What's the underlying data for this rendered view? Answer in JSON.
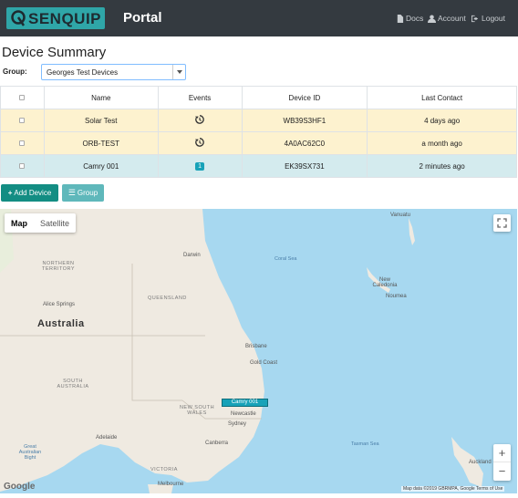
{
  "header": {
    "logo_text": "SENQUIP",
    "brand": "Portal",
    "links": {
      "docs": "Docs",
      "account": "Account",
      "logout": "Logout"
    }
  },
  "page": {
    "title": "Device Summary",
    "group_label": "Group:",
    "group_value": "Georges Test Devices"
  },
  "table": {
    "headers": {
      "name": "Name",
      "events": "Events",
      "device_id": "Device ID",
      "last_contact": "Last Contact"
    },
    "rows": [
      {
        "name": "Solar Test",
        "events": "history-icon",
        "device_id": "WB39S3HF1",
        "last_contact": "4 days ago",
        "status": "warning"
      },
      {
        "name": "ORB-TEST",
        "events": "history-icon",
        "device_id": "4A0AC62C0",
        "last_contact": "a month ago",
        "status": "warning"
      },
      {
        "name": "Camry 001",
        "events": "1",
        "device_id": "EK39SX731",
        "last_contact": "2 minutes ago",
        "status": "info"
      }
    ]
  },
  "actions": {
    "add_device": "Add Device",
    "group": "Group"
  },
  "map": {
    "map_type_options": [
      "Map",
      "Satellite"
    ],
    "selected_map_type": "Map",
    "country_label": "Australia",
    "state_labels": {
      "nt": "NORTHERN TERRITORY",
      "qld": "QUEENSLAND",
      "sa": "SOUTH AUSTRALIA",
      "nsw": "NEW SOUTH WALES",
      "vic": "VICTORIA"
    },
    "place_labels": {
      "darwin": "Darwin",
      "alice": "Alice Springs",
      "brisbane": "Brisbane",
      "goldcoast": "Gold Coast",
      "newcastle": "Newcastle",
      "sydney": "Sydney",
      "canberra": "Canberra",
      "adelaide": "Adelaide",
      "melbourne": "Melbourne",
      "vanuatu": "Vanuatu",
      "newcaledonia": "New Caledonia",
      "noumea": "Noumea",
      "auckland": "Auckland"
    },
    "sea_labels": {
      "coral": "Coral Sea",
      "bight": "Great Australian Bight",
      "tasman": "Tasman Sea"
    },
    "marker_label": "Camry 001",
    "google_label": "Google",
    "attribution": "Map data ©2019 GBRMPA, Google  Terms of Use",
    "zoom_in": "+",
    "zoom_out": "−"
  },
  "colors": {
    "navbar": "#343a40",
    "brand_accent": "#2fa6a8",
    "warning_row": "#fdf2cf",
    "info_row": "#d4ebee",
    "badge": "#17a2b8",
    "add_button": "#138d83"
  }
}
